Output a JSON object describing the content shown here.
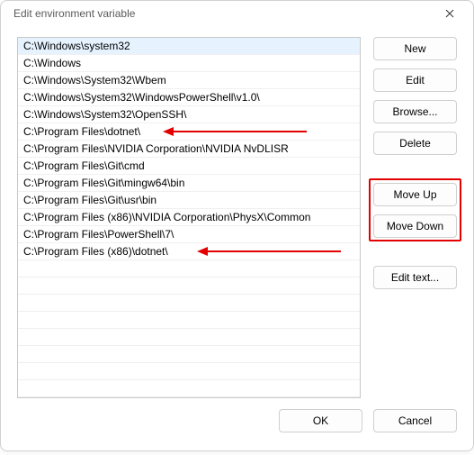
{
  "window": {
    "title": "Edit environment variable"
  },
  "list": {
    "items": [
      "C:\\Windows\\system32",
      "C:\\Windows",
      "C:\\Windows\\System32\\Wbem",
      "C:\\Windows\\System32\\WindowsPowerShell\\v1.0\\",
      "C:\\Windows\\System32\\OpenSSH\\",
      "C:\\Program Files\\dotnet\\",
      "C:\\Program Files\\NVIDIA Corporation\\NVIDIA NvDLISR",
      "C:\\Program Files\\Git\\cmd",
      "C:\\Program Files\\Git\\mingw64\\bin",
      "C:\\Program Files\\Git\\usr\\bin",
      "C:\\Program Files (x86)\\NVIDIA Corporation\\PhysX\\Common",
      "C:\\Program Files\\PowerShell\\7\\",
      "C:\\Program Files (x86)\\dotnet\\"
    ],
    "selected_index": 0
  },
  "buttons": {
    "new": "New",
    "edit": "Edit",
    "browse": "Browse...",
    "delete": "Delete",
    "move_up": "Move Up",
    "move_down": "Move Down",
    "edit_text": "Edit text...",
    "ok": "OK",
    "cancel": "Cancel"
  },
  "annotations": {
    "arrows": [
      {
        "target_index": 5
      },
      {
        "target_index": 12
      }
    ],
    "highlighted_buttons": [
      "move_up",
      "move_down"
    ],
    "color": "#e30000"
  }
}
